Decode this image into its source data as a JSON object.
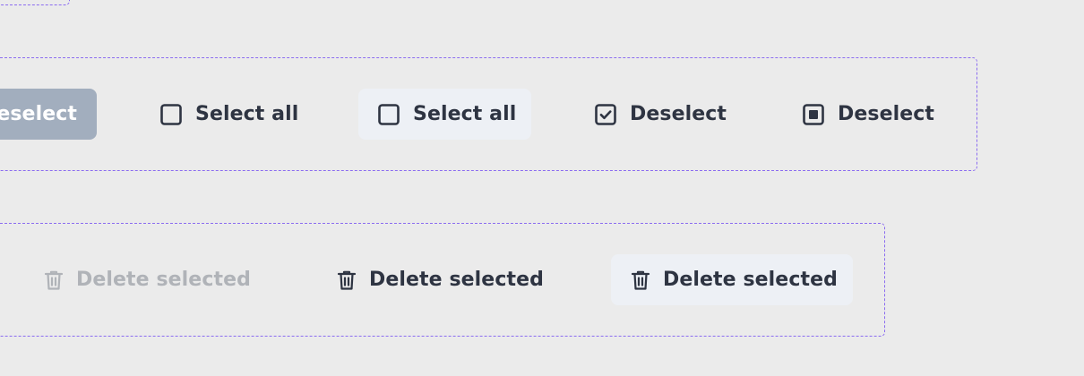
{
  "select_group": {
    "solid_button_label": "eselect",
    "select_all_plain_label": "Select all",
    "select_all_soft_label": "Select all",
    "deselect_check_label": "Deselect",
    "deselect_square_label": "Deselect"
  },
  "delete_group": {
    "disabled_label": "Delete selected",
    "plain_label": "Delete selected",
    "soft_label": "Delete selected"
  },
  "icons": {
    "checkbox_empty": "checkbox-empty-icon",
    "checkbox_checked": "checkbox-checked-icon",
    "checkbox_indeterminate": "checkbox-indeterminate-icon",
    "trash": "trash-icon"
  },
  "colors": {
    "background": "#ebebeb",
    "frame_border": "#8b6cf0",
    "text": "#2e3442",
    "disabled_text": "#b0b3b8",
    "solid_button_bg": "#a2aebe",
    "soft_button_bg": "#edf0f5"
  }
}
